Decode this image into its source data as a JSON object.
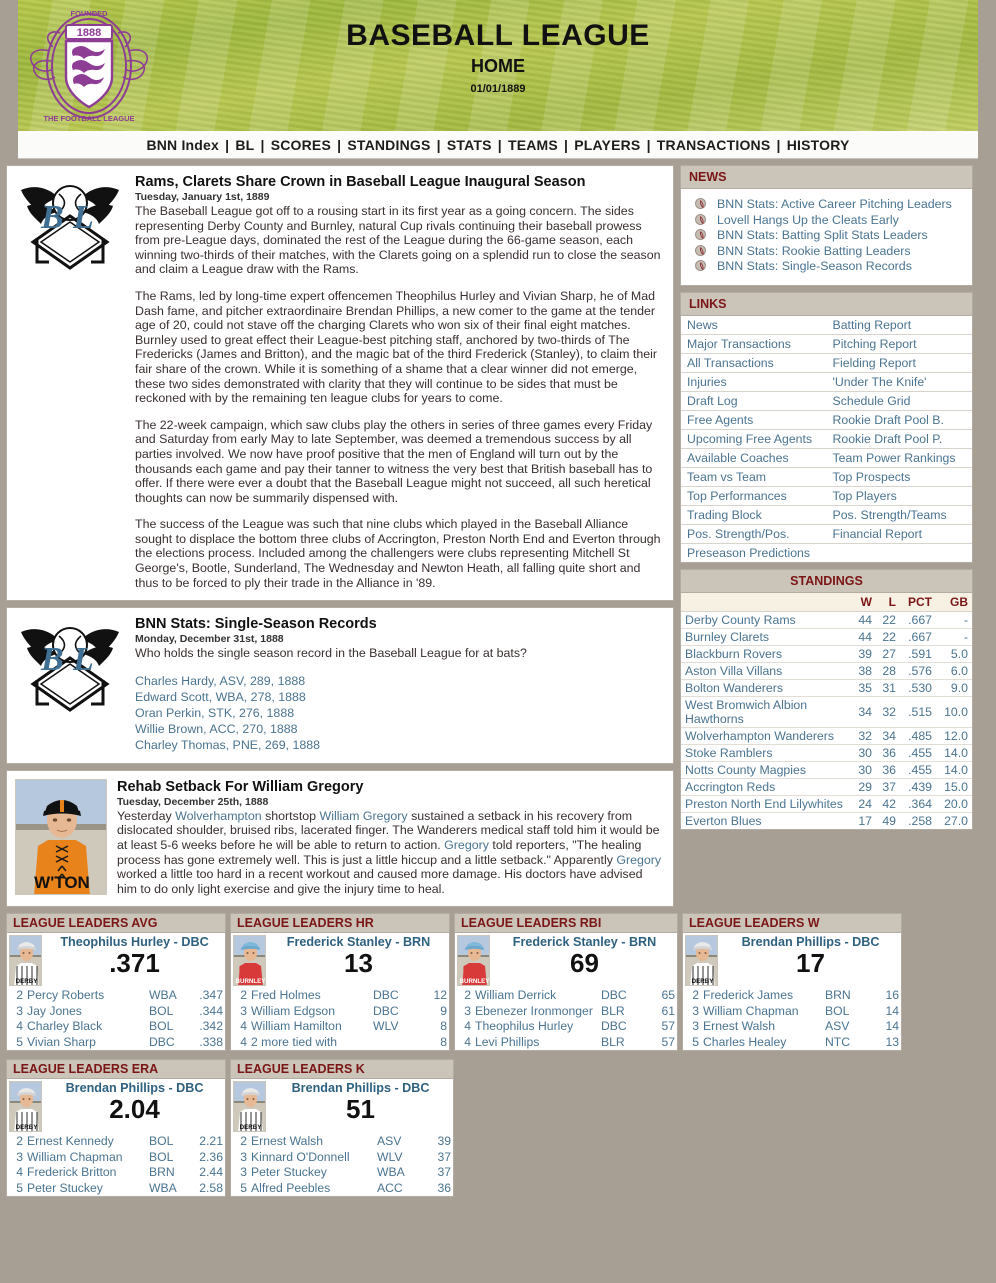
{
  "header": {
    "crest_icon": "fa-crest-1888",
    "crest_year": "1888",
    "title": "BASEBALL LEAGUE",
    "subtitle": "HOME",
    "date": "01/01/1889"
  },
  "nav": {
    "items": [
      "BNN Index",
      "BL",
      "SCORES",
      "STANDINGS",
      "STATS",
      "TEAMS",
      "PLAYERS",
      "TRANSACTIONS",
      "HISTORY"
    ],
    "separator": "|"
  },
  "articles": [
    {
      "logo_icon": "bsl-winged-baseball-logo",
      "title": "Rams, Clarets Share Crown in Baseball League Inaugural Season",
      "date": "Tuesday, January 1st, 1889",
      "paragraphs": [
        "The Baseball League got off to a rousing start in its first year as a going concern. The sides representing Derby County and Burnley, natural Cup rivals continuing their baseball prowess from pre-League days, dominated the rest of the League during the 66-game season, each winning two-thirds of their matches, with the Clarets going on a splendid run to close the season and claim a League draw with the Rams.",
        "The Rams, led by long-time expert offencemen Theophilus Hurley and Vivian Sharp, he of Mad Dash fame, and pitcher extraordinaire Brendan Phillips, a new comer to the game at the tender age of 20, could not stave off the charging Clarets who won six of their final eight matches. Burnley used to great effect their League-best pitching staff, anchored by two-thirds of The Fredericks (James and Britton), and the magic bat of the third Frederick (Stanley), to claim their fair share of the crown. While it is something of a shame that a clear winner did not emerge, these two sides demonstrated with clarity that they will continue to be sides that must be reckoned with by the remaining ten league clubs for years to come.",
        "The 22-week campaign, which saw clubs play the others in series of three games every Friday and Saturday from early May to late September, was deemed a tremendous success by all parties involved. We now have proof positive that the men of England will turn out by the thousands each game and pay their tanner to witness the very best that British baseball has to offer. If there were ever a doubt that the Baseball League might not succeed, all such heretical thoughts can now be summarily dispensed with.",
        "The success of the League was such that nine clubs which played in the Baseball Alliance sought to displace the bottom three clubs of Accrington, Preston North End and Everton through the elections process. Included among the challengers were clubs representing Mitchell St George's, Bootle, Sunderland, The Wednesday and Newton Heath, all falling quite short and thus to be forced to ply their trade in the Alliance in '89."
      ]
    },
    {
      "logo_icon": "bsl-winged-baseball-logo",
      "title": "BNN Stats: Single-Season Records",
      "date": "Monday, December 31st, 1888",
      "question": "Who holds the single season record in the Baseball League for at bats?",
      "records": [
        "Charles Hardy, ASV, 289, 1888",
        "Edward Scott, WBA, 278, 1888",
        "Oran Perkin, STK, 276, 1888",
        "Willie Brown, ACC, 270, 1888",
        "Charley Thomas, PNE, 269, 1888"
      ]
    },
    {
      "photo_icon": "player-portrait-wton",
      "photo_jersey_text": "W'TON",
      "title": "Rehab Setback For William Gregory",
      "date": "Tuesday, December 25th, 1888",
      "body_html": "Yesterday <span class='lnk'>Wolverhampton</span> shortstop <span class='lnk'>William Gregory</span> sustained a setback in his recovery from dislocated shoulder, bruised ribs, lacerated finger. The Wanderers medical staff told him it would be at least 5-6 weeks before he will be able to return to action. <span class='lnk'>Gregory</span> told reporters, \"The healing process has gone extremely well. This is just a little hiccup and a little setback.\" Apparently <span class='lnk'>Gregory</span> worked a little too hard in a recent workout and caused more damage. His doctors have advised him to do only light exercise and give the injury time to heal."
    }
  ],
  "news": {
    "heading": "NEWS",
    "items": [
      "BNN Stats: Active Career Pitching Leaders",
      "Lovell Hangs Up the Cleats Early",
      "BNN Stats: Batting Split Stats Leaders",
      "BNN Stats: Rookie Batting Leaders",
      "BNN Stats: Single-Season Records"
    ]
  },
  "links": {
    "heading": "LINKS",
    "rows": [
      [
        "News",
        "Batting Report"
      ],
      [
        "Major Transactions",
        "Pitching Report"
      ],
      [
        "All Transactions",
        "Fielding Report"
      ],
      [
        "Injuries",
        "'Under The Knife'"
      ],
      [
        "Draft Log",
        "Schedule Grid"
      ],
      [
        "Free Agents",
        "Rookie Draft Pool B."
      ],
      [
        "Upcoming Free Agents",
        "Rookie Draft Pool P."
      ],
      [
        "Available Coaches",
        "Team Power Rankings"
      ],
      [
        "Team vs Team",
        "Top Prospects"
      ],
      [
        "Top Performances",
        "Top Players"
      ],
      [
        "Trading Block",
        "Pos. Strength/Teams"
      ],
      [
        "Pos. Strength/Pos.",
        "Financial Report"
      ],
      [
        "Preseason Predictions",
        ""
      ]
    ]
  },
  "standings": {
    "heading": "STANDINGS",
    "columns": [
      "",
      "W",
      "L",
      "PCT",
      "GB"
    ],
    "rows": [
      [
        "Derby County Rams",
        "44",
        "22",
        ".667",
        "-"
      ],
      [
        "Burnley Clarets",
        "44",
        "22",
        ".667",
        "-"
      ],
      [
        "Blackburn Rovers",
        "39",
        "27",
        ".591",
        "5.0"
      ],
      [
        "Aston Villa Villans",
        "38",
        "28",
        ".576",
        "6.0"
      ],
      [
        "Bolton Wanderers",
        "35",
        "31",
        ".530",
        "9.0"
      ],
      [
        "West Bromwich Albion Hawthorns",
        "34",
        "32",
        ".515",
        "10.0"
      ],
      [
        "Wolverhampton Wanderers",
        "32",
        "34",
        ".485",
        "12.0"
      ],
      [
        "Stoke Ramblers",
        "30",
        "36",
        ".455",
        "14.0"
      ],
      [
        "Notts County Magpies",
        "30",
        "36",
        ".455",
        "14.0"
      ],
      [
        "Accrington Reds",
        "29",
        "37",
        ".439",
        "15.0"
      ],
      [
        "Preston North End Lilywhites",
        "24",
        "42",
        ".364",
        "20.0"
      ],
      [
        "Everton Blues",
        "17",
        "49",
        ".258",
        "27.0"
      ]
    ]
  },
  "leaders": [
    {
      "heading": "LEAGUE LEADERS AVG",
      "photo_icon": "player-portrait-derby",
      "jersey_text": "DERBY",
      "jersey_style": "white",
      "leader_name": "Theophilus Hurley",
      "leader_team": "DBC",
      "leader_value": ".371",
      "rows": [
        {
          "rank": "2",
          "name": "Percy Roberts",
          "team": "WBA",
          "value": ".347"
        },
        {
          "rank": "3",
          "name": "Jay Jones",
          "team": "BOL",
          "value": ".344"
        },
        {
          "rank": "4",
          "name": "Charley Black",
          "team": "BOL",
          "value": ".342"
        },
        {
          "rank": "5",
          "name": "Vivian  Sharp",
          "team": "DBC",
          "value": ".338"
        }
      ]
    },
    {
      "heading": "LEAGUE LEADERS HR",
      "photo_icon": "player-portrait-burnley",
      "jersey_text": "BURNLEY",
      "jersey_style": "red",
      "leader_name": "Frederick  Stanley",
      "leader_team": "BRN",
      "leader_value": "13",
      "rows": [
        {
          "rank": "2",
          "name": "Fred Holmes",
          "team": "DBC",
          "value": "12"
        },
        {
          "rank": "3",
          "name": "William Edgson",
          "team": "DBC",
          "value": "9"
        },
        {
          "rank": "4",
          "name": "William Hamilton",
          "team": "WLV",
          "value": "8"
        },
        {
          "rank": "4",
          "name": "2 more tied with",
          "team": "",
          "value": "8"
        }
      ]
    },
    {
      "heading": "LEAGUE LEADERS RBI",
      "photo_icon": "player-portrait-burnley",
      "jersey_text": "BURNLEY",
      "jersey_style": "red",
      "leader_name": "Frederick Stanley",
      "leader_team": "BRN",
      "leader_value": "69",
      "rows": [
        {
          "rank": "2",
          "name": "William Derrick",
          "team": "DBC",
          "value": "65"
        },
        {
          "rank": "3",
          "name": "Ebenezer Ironmonger",
          "team": "BLR",
          "value": "61"
        },
        {
          "rank": "4",
          "name": "Theophilus Hurley",
          "team": "DBC",
          "value": "57"
        },
        {
          "rank": "4",
          "name": "Levi Phillips",
          "team": "BLR",
          "value": "57"
        }
      ]
    },
    {
      "heading": "LEAGUE LEADERS W",
      "photo_icon": "player-portrait-derby",
      "jersey_text": "DERBY",
      "jersey_style": "white",
      "leader_name": "Brendan Phillips",
      "leader_team": "DBC",
      "leader_value": "17",
      "rows": [
        {
          "rank": "2",
          "name": "Frederick James",
          "team": "BRN",
          "value": "16"
        },
        {
          "rank": "3",
          "name": "William Chapman",
          "team": "BOL",
          "value": "14"
        },
        {
          "rank": "3",
          "name": "Ernest Walsh",
          "team": "ASV",
          "value": "14"
        },
        {
          "rank": "5",
          "name": "Charles Healey",
          "team": "NTC",
          "value": "13"
        }
      ]
    },
    {
      "heading": "LEAGUE LEADERS ERA",
      "photo_icon": "player-portrait-derby",
      "jersey_text": "DERBY",
      "jersey_style": "white",
      "leader_name": "Brendan Phillips",
      "leader_team": "DBC",
      "leader_value": "2.04",
      "rows": [
        {
          "rank": "2",
          "name": "Ernest Kennedy",
          "team": "BOL",
          "value": "2.21"
        },
        {
          "rank": "3",
          "name": "William Chapman",
          "team": "BOL",
          "value": "2.36"
        },
        {
          "rank": "4",
          "name": "Frederick Britton",
          "team": "BRN",
          "value": "2.44"
        },
        {
          "rank": "5",
          "name": "Peter Stuckey",
          "team": "WBA",
          "value": "2.58"
        }
      ]
    },
    {
      "heading": "LEAGUE LEADERS K",
      "photo_icon": "player-portrait-derby",
      "jersey_text": "DERBY",
      "jersey_style": "white",
      "leader_name": "Brendan Phillips",
      "leader_team": "DBC",
      "leader_value": "51",
      "rows": [
        {
          "rank": "2",
          "name": "Ernest Walsh",
          "team": "ASV",
          "value": "39"
        },
        {
          "rank": "3",
          "name": "Kinnard O'Donnell",
          "team": "WLV",
          "value": "37"
        },
        {
          "rank": "3",
          "name": "Peter Stuckey",
          "team": "WBA",
          "value": "37"
        },
        {
          "rank": "5",
          "name": "Alfred Peebles",
          "team": "ACC",
          "value": "36"
        }
      ]
    }
  ],
  "colors": {
    "panel_heading": "#7b1616",
    "link": "#4a7491",
    "panel_head_bg": "#cbc4b9",
    "page_bg": "#a79f94",
    "crest": "#8e3d95"
  }
}
